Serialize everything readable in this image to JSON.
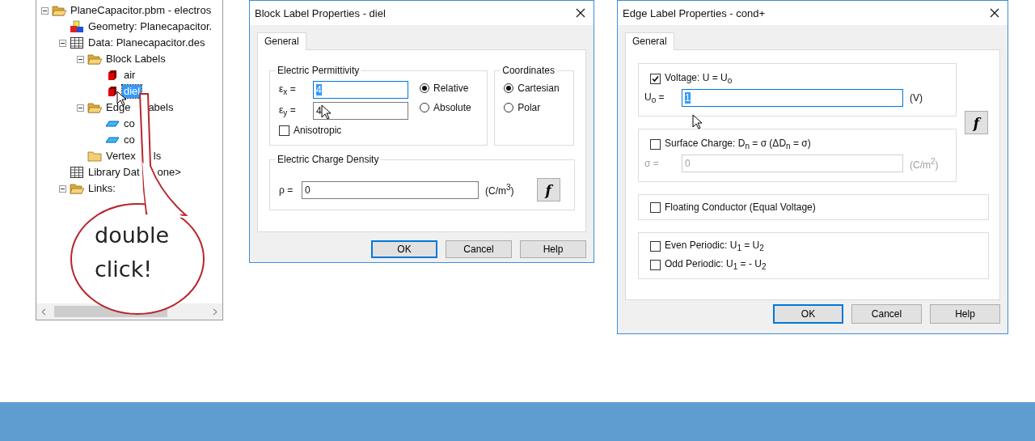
{
  "tree": {
    "nodes": [
      {
        "label": "PlaneCapacitor.pbm - electros",
        "kind": "folder-open",
        "expanded": true,
        "selected": false,
        "children": [
          {
            "label": "Geometry: Planecapacitor.",
            "kind": "geometry",
            "selected": false
          },
          {
            "label": "Data: Planecapacitor.des",
            "kind": "table",
            "expanded": true,
            "selected": false,
            "children": [
              {
                "label": "Block Labels",
                "kind": "folder-open",
                "expanded": true,
                "selected": false,
                "children": [
                  {
                    "label": "air",
                    "kind": "block",
                    "selected": false
                  },
                  {
                    "label": "diel",
                    "kind": "block",
                    "selected": true
                  }
                ]
              },
              {
                "label": "Edge",
                "label_after_pointer": "abels",
                "kind": "folder-open",
                "expanded": true,
                "selected": false,
                "children": [
                  {
                    "label": "co",
                    "kind": "edge",
                    "selected": false
                  },
                  {
                    "label": "co",
                    "kind": "edge",
                    "selected": false
                  }
                ]
              },
              {
                "label": "Vertex",
                "label_after_pointer": "ls",
                "kind": "folder",
                "selected": false
              }
            ]
          },
          {
            "label": "Library Dat",
            "label_after_pointer": "one>",
            "kind": "table",
            "selected": false
          },
          {
            "label": "Links:",
            "kind": "folder-open",
            "expanded": true,
            "selected": false
          }
        ]
      }
    ]
  },
  "callout": {
    "lines": [
      "double",
      "click!"
    ]
  },
  "block_dialog": {
    "title": "Block Label Properties - diel",
    "tabs": [
      {
        "label": "General",
        "selected": true
      }
    ],
    "permittivity": {
      "title": "Electric Permittivity",
      "fields": [
        {
          "label": "ε$_{x}$ =",
          "value": "4",
          "focused": true
        },
        {
          "label": "ε$_{y}$ =",
          "value": "4",
          "focused": false
        }
      ],
      "options": [
        {
          "label": "Relative",
          "selected": true
        },
        {
          "label": "Absolute",
          "selected": false
        }
      ],
      "anisotropic": {
        "label": "Anisotropic",
        "checked": false
      }
    },
    "coordinates": {
      "title": "Coordinates",
      "options": [
        {
          "label": "Cartesian",
          "selected": true
        },
        {
          "label": "Polar",
          "selected": false
        }
      ]
    },
    "charge": {
      "title": "Electric Charge Density",
      "label": "ρ =",
      "value": "0",
      "unit": "(C/m$^{3}$)",
      "function_button": "f"
    },
    "buttons": [
      {
        "label": "OK",
        "default": true
      },
      {
        "label": "Cancel",
        "default": false
      },
      {
        "label": "Help",
        "default": false
      }
    ]
  },
  "edge_dialog": {
    "title": "Edge Label Properties - cond+",
    "tabs": [
      {
        "label": "General",
        "selected": true
      }
    ],
    "groups": [
      {
        "kind": "field",
        "checkbox": {
          "label": "Voltage: U = U$_{o}$",
          "checked": true
        },
        "field": {
          "label": "U$_{o}$ =",
          "value": "1",
          "unit": "(V)",
          "focused": true,
          "disabled": false
        }
      },
      {
        "kind": "field",
        "checkbox": {
          "label": "Surface Charge: D$_{n}$ = σ (ΔD$_{n}$ = σ)",
          "checked": false
        },
        "field": {
          "label": "σ =",
          "value": "0",
          "unit": "(C/m$^{2}$)",
          "focused": false,
          "disabled": true
        }
      },
      {
        "kind": "checks",
        "checkboxes": [
          {
            "label": "Floating Conductor (Equal Voltage)",
            "checked": false
          }
        ]
      },
      {
        "kind": "checks",
        "checkboxes": [
          {
            "label": "Even Periodic: U$_{1}$ = U$_{2}$",
            "checked": false
          },
          {
            "label": "Odd Periodic: U$_{1}$ = - U$_{2}$",
            "checked": false
          }
        ]
      }
    ],
    "function_button": "f",
    "buttons": [
      {
        "label": "OK",
        "default": true
      },
      {
        "label": "Cancel",
        "default": false
      },
      {
        "label": "Help",
        "default": false
      }
    ]
  }
}
